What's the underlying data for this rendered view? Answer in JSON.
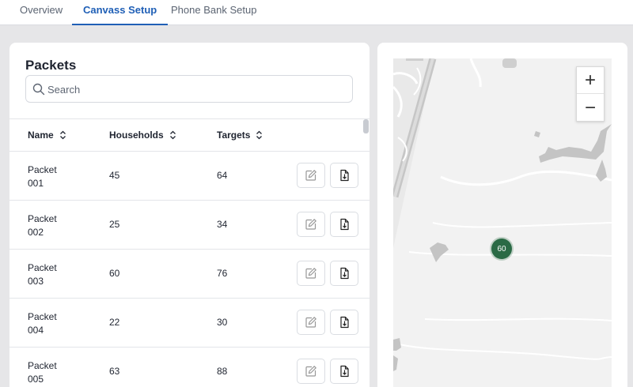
{
  "tabs": [
    {
      "label": "Overview",
      "active": false
    },
    {
      "label": "Canvass Setup",
      "active": true
    },
    {
      "label": "Phone Bank Setup",
      "active": false
    }
  ],
  "packets": {
    "title": "Packets",
    "search": {
      "placeholder": "Search",
      "value": ""
    },
    "columns": [
      "Name",
      "Households",
      "Targets"
    ],
    "rows": [
      {
        "name": "Packet 001",
        "households": "45",
        "targets": "64"
      },
      {
        "name": "Packet 002",
        "households": "25",
        "targets": "34"
      },
      {
        "name": "Packet 003",
        "households": "60",
        "targets": "76"
      },
      {
        "name": "Packet 004",
        "households": "22",
        "targets": "30"
      },
      {
        "name": "Packet 005",
        "households": "63",
        "targets": "88"
      }
    ],
    "actions": {
      "edit_icon": "edit-icon",
      "download_icon": "download-file-icon"
    }
  },
  "map": {
    "zoom_in_label": "+",
    "zoom_out_label": "−",
    "cluster_count": "60",
    "cluster_color": "#2a6a45"
  },
  "colors": {
    "accent": "#1f5fb6",
    "background": "#e6e6e8"
  }
}
